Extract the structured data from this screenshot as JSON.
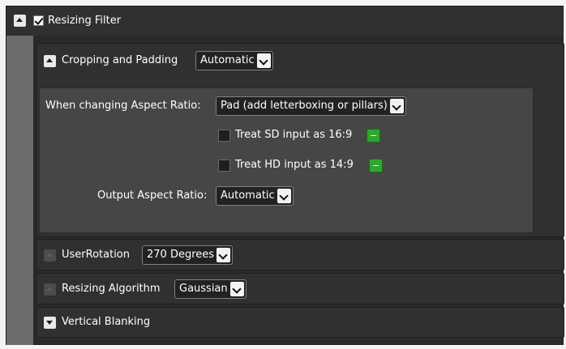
{
  "resizing_filter": {
    "label": "Resizing Filter",
    "enabled": true,
    "expanded": true
  },
  "cropping_padding": {
    "label": "Cropping and Padding",
    "mode": "Automatic",
    "expanded": true,
    "aspect_ratio_label": "When changing Aspect Ratio:",
    "aspect_ratio_value": "Pad (add letterboxing or pillars)",
    "treat_sd_label": "Treat SD input as 16:9",
    "treat_sd_checked": false,
    "treat_hd_label": "Treat HD input as 14:9",
    "treat_hd_checked": false,
    "output_aspect_label": "Output Aspect Ratio:",
    "output_aspect_value": "Automatic"
  },
  "user_rotation": {
    "label": "UserRotation",
    "value": "270 Degrees"
  },
  "resizing_algorithm": {
    "label": "Resizing Algorithm",
    "value": "Gaussian"
  },
  "vertical_blanking": {
    "label": "Vertical Blanking"
  },
  "colors": {
    "panel_bg": "#303030",
    "inner_bg": "#464646",
    "sidebar": "#6c6c6c",
    "accent_green": "#2fa62f"
  }
}
